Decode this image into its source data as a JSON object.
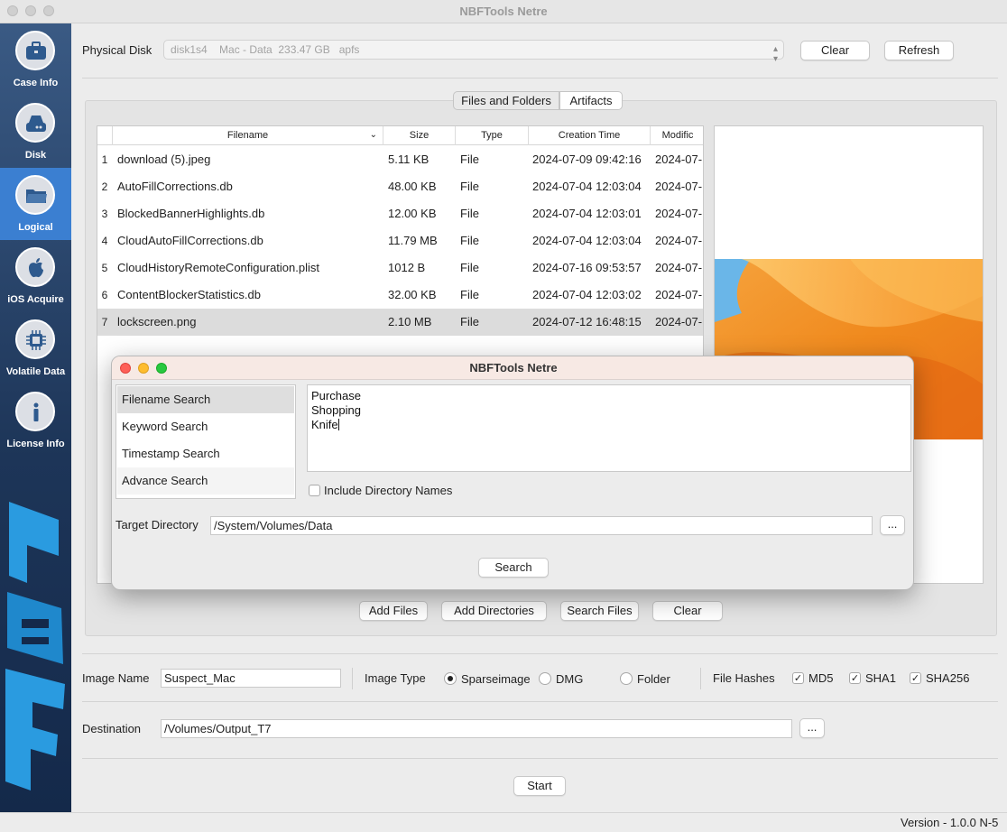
{
  "window": {
    "title": "NBFTools Netre"
  },
  "sidebar": {
    "items": [
      {
        "label": "Case Info",
        "icon": "briefcase-icon",
        "active": false
      },
      {
        "label": "Disk",
        "icon": "hard-disk-icon",
        "active": false
      },
      {
        "label": "Logical",
        "icon": "folder-icon",
        "active": true
      },
      {
        "label": "iOS Acquire",
        "icon": "apple-icon",
        "active": false
      },
      {
        "label": "Volatile Data",
        "icon": "chip-icon",
        "active": false
      },
      {
        "label": "License Info",
        "icon": "info-icon",
        "active": false
      }
    ],
    "logo_text": "NBF"
  },
  "disk": {
    "label": "Physical Disk",
    "selected": "disk1s4    Mac - Data  233.47 GB   apfs",
    "clear_label": "Clear",
    "refresh_label": "Refresh"
  },
  "tabs": [
    {
      "label": "Files and Folders",
      "active": true
    },
    {
      "label": "Artifacts",
      "active": false
    }
  ],
  "table": {
    "columns": [
      "Filename",
      "Size",
      "Type",
      "Creation Time",
      "Modific"
    ],
    "rows": [
      {
        "num": "1",
        "filename": "download (5).jpeg",
        "size": "5.11 KB",
        "type": "File",
        "created": "2024-07-09 09:42:16",
        "modified": "2024-07-"
      },
      {
        "num": "2",
        "filename": "AutoFillCorrections.db",
        "size": "48.00 KB",
        "type": "File",
        "created": "2024-07-04 12:03:04",
        "modified": "2024-07-"
      },
      {
        "num": "3",
        "filename": "BlockedBannerHighlights.db",
        "size": "12.00 KB",
        "type": "File",
        "created": "2024-07-04 12:03:01",
        "modified": "2024-07-"
      },
      {
        "num": "4",
        "filename": "CloudAutoFillCorrections.db",
        "size": "11.79 MB",
        "type": "File",
        "created": "2024-07-04 12:03:04",
        "modified": "2024-07-"
      },
      {
        "num": "5",
        "filename": "CloudHistoryRemoteConfiguration.plist",
        "size": "1012 B",
        "type": "File",
        "created": "2024-07-16 09:53:57",
        "modified": "2024-07-"
      },
      {
        "num": "6",
        "filename": "ContentBlockerStatistics.db",
        "size": "32.00 KB",
        "type": "File",
        "created": "2024-07-04 12:03:02",
        "modified": "2024-07-"
      },
      {
        "num": "7",
        "filename": "lockscreen.png",
        "size": "2.10 MB",
        "type": "File",
        "created": "2024-07-12 16:48:15",
        "modified": "2024-07-",
        "selected": true
      }
    ]
  },
  "file_actions": {
    "add_files": "Add Files",
    "add_directories": "Add Directories",
    "search_files": "Search Files",
    "clear": "Clear"
  },
  "dialog": {
    "title": "NBFTools Netre",
    "search_types": [
      "Filename Search",
      "Keyword Search",
      "Timestamp Search",
      "Advance Search"
    ],
    "terms": [
      "Purchase",
      "Shopping",
      "Knife"
    ],
    "include_dirs_label": "Include Directory Names",
    "include_dirs_checked": false,
    "target_dir_label": "Target Directory",
    "target_dir_value": "/System/Volumes/Data",
    "browse_label": "...",
    "search_label": "Search"
  },
  "image": {
    "name_label": "Image Name",
    "name_value": "Suspect_Mac",
    "type_label": "Image Type",
    "types": [
      {
        "label": "Sparseimage",
        "selected": true
      },
      {
        "label": "DMG",
        "selected": false
      },
      {
        "label": "Folder",
        "selected": false
      }
    ],
    "hashes_label": "File Hashes",
    "hashes": [
      {
        "label": "MD5",
        "checked": true
      },
      {
        "label": "SHA1",
        "checked": true
      },
      {
        "label": "SHA256",
        "checked": true
      }
    ]
  },
  "destination": {
    "label": "Destination",
    "value": "/Volumes/Output_T7",
    "browse_label": "..."
  },
  "start_label": "Start",
  "status": {
    "version": "Version - 1.0.0 N-5"
  },
  "colors": {
    "sidebar_active": "#3b7fd1",
    "sidebar_bg": "#1d3558",
    "logo_blue": "#2a9be0"
  }
}
